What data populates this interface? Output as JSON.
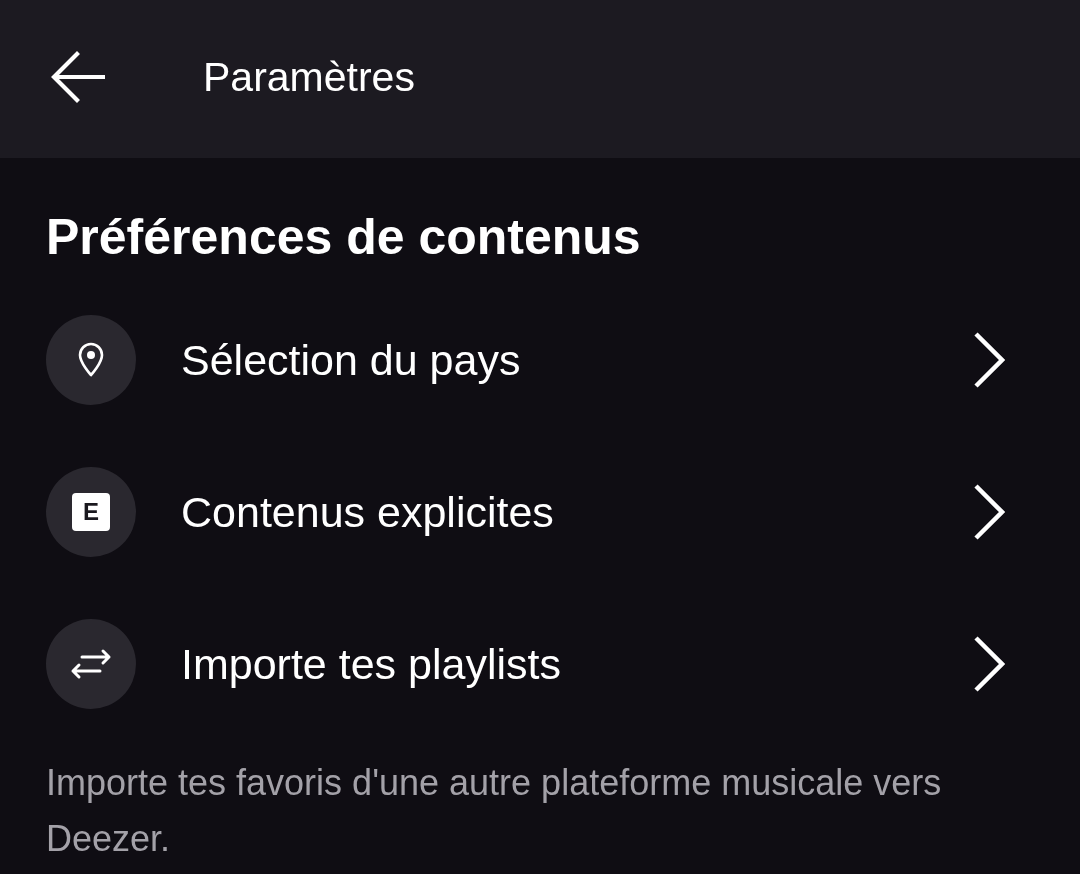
{
  "header": {
    "title": "Paramètres"
  },
  "section": {
    "title": "Préférences de contenus"
  },
  "items": [
    {
      "kind": "location",
      "label": "Sélection du pays"
    },
    {
      "kind": "explicit",
      "label": "Contenus explicites",
      "badge": "E"
    },
    {
      "kind": "transfer",
      "label": "Importe tes playlists"
    }
  ],
  "description": "Importe tes favoris d'une autre plateforme musicale vers Deezer."
}
